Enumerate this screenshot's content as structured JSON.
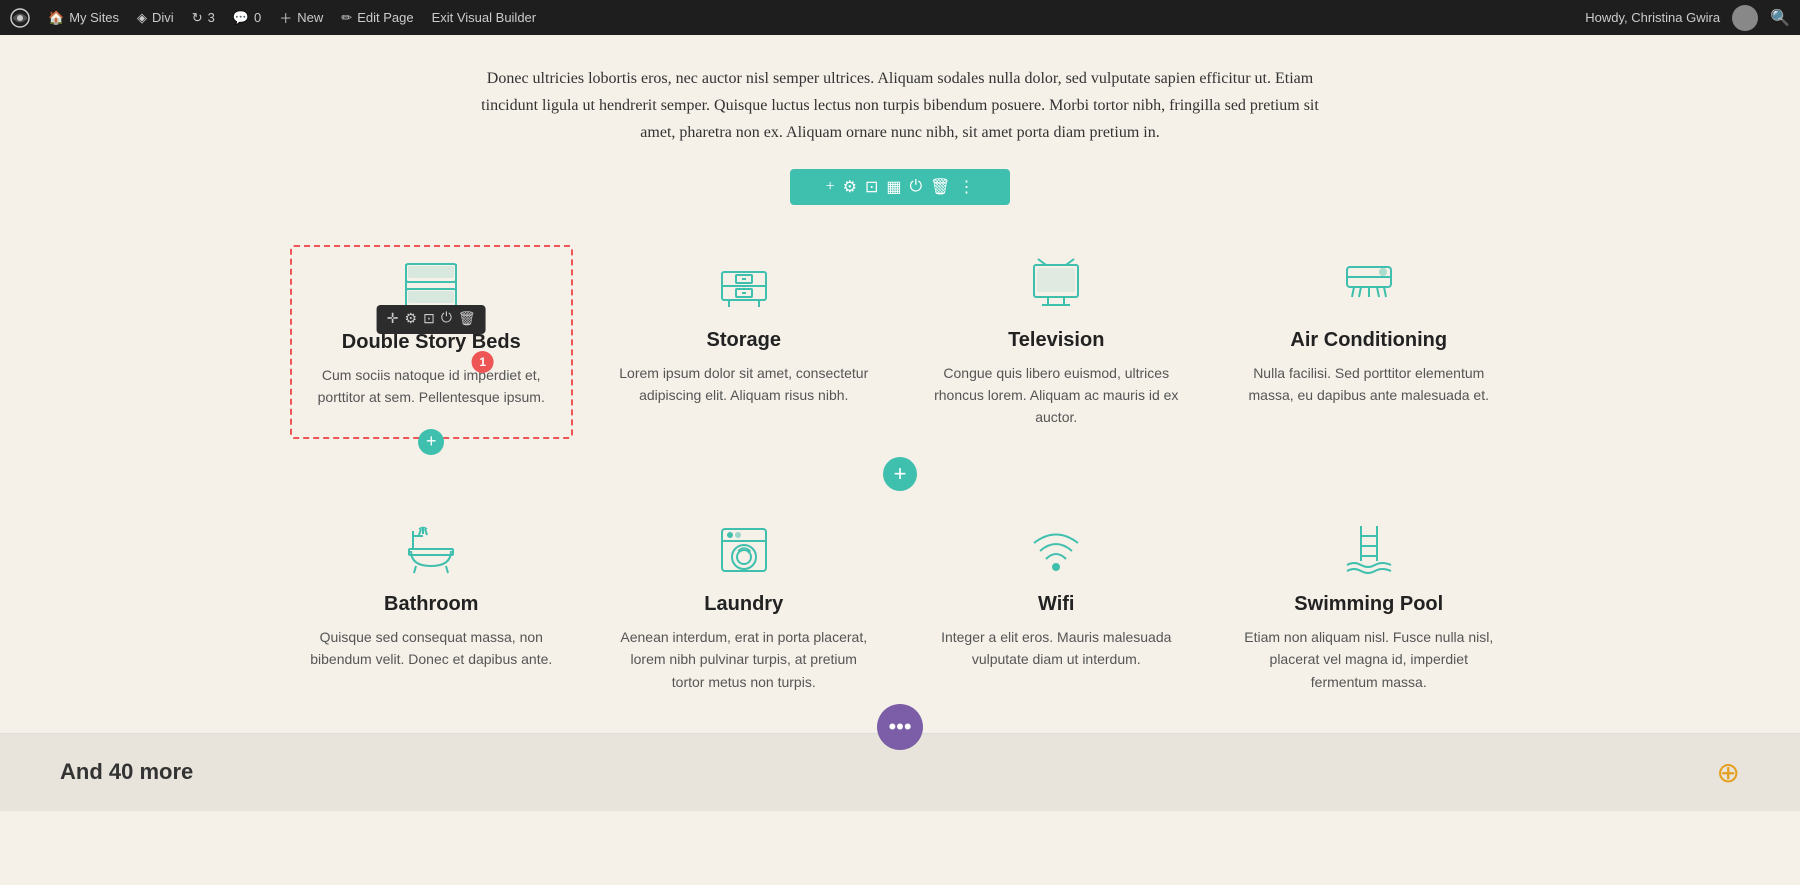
{
  "adminBar": {
    "wpIcon": "⊞",
    "mySites": "My Sites",
    "divi": "Divi",
    "updates": "3",
    "comments": "0",
    "new": "New",
    "editPage": "Edit Page",
    "exitBuilder": "Exit Visual Builder",
    "howdy": "Howdy, Christina Gwira",
    "searchIcon": "🔍"
  },
  "introText": "Donec ultricies lobortis eros, nec auctor nisl semper ultrices. Aliquam sodales nulla dolor, sed vulputate sapien efficitur ut. Etiam tincidunt ligula ut hendrerit semper. Quisque luctus lectus non turpis bibendum posuere. Morbi tortor nibh, fringilla sed pretium sit amet, pharetra non ex. Aliquam ornare nunc nibh, sit amet porta diam pretium in.",
  "sectionToolbar": {
    "icons": [
      "+",
      "⚙",
      "⊡",
      "▦",
      "⏻",
      "🗑",
      "⋮"
    ]
  },
  "features": [
    {
      "id": "double-story-beds",
      "title": "Double Story Beds",
      "desc": "Cum sociis natoque id imperdiet et, porttitor at sem. Pellentesque ipsum.",
      "icon": "beds",
      "selected": true
    },
    {
      "id": "storage",
      "title": "Storage",
      "desc": "Lorem ipsum dolor sit amet, consectetur adipiscing elit. Aliquam risus nibh.",
      "icon": "storage",
      "selected": false
    },
    {
      "id": "television",
      "title": "Television",
      "desc": "Congue quis libero euismod, ultrices rhoncus lorem. Aliquam ac mauris id ex auctor.",
      "icon": "television",
      "selected": false
    },
    {
      "id": "air-conditioning",
      "title": "Air Conditioning",
      "desc": "Nulla facilisi. Sed porttitor elementum massa, eu dapibus ante malesuada et.",
      "icon": "ac",
      "selected": false
    },
    {
      "id": "bathroom",
      "title": "Bathroom",
      "desc": "Quisque sed consequat massa, non bibendum velit. Donec et dapibus ante.",
      "icon": "bathroom",
      "selected": false
    },
    {
      "id": "laundry",
      "title": "Laundry",
      "desc": "Aenean interdum, erat in porta placerat, lorem nibh pulvinar turpis, at pretium tortor metus non turpis.",
      "icon": "laundry",
      "selected": false
    },
    {
      "id": "wifi",
      "title": "Wifi",
      "desc": "Integer a elit eros. Mauris malesuada vulputate diam ut interdum.",
      "icon": "wifi",
      "selected": false
    },
    {
      "id": "swimming-pool",
      "title": "Swimming Pool",
      "desc": "Etiam non aliquam nisl. Fusce nulla nisl, placerat vel magna id, imperdiet fermentum massa.",
      "icon": "pool",
      "selected": false
    }
  ],
  "miniToolbar": {
    "icons": [
      "+",
      "⚙",
      "⊡",
      "⏻",
      "🗑"
    ],
    "notificationCount": "1"
  },
  "moreBar": {
    "title": "And 40 more"
  },
  "colors": {
    "teal": "#3fbfad",
    "darkBg": "#1e1e1e",
    "pageBg": "#f5f0e8",
    "purple": "#7b5ea7",
    "orange": "#e5a020"
  }
}
